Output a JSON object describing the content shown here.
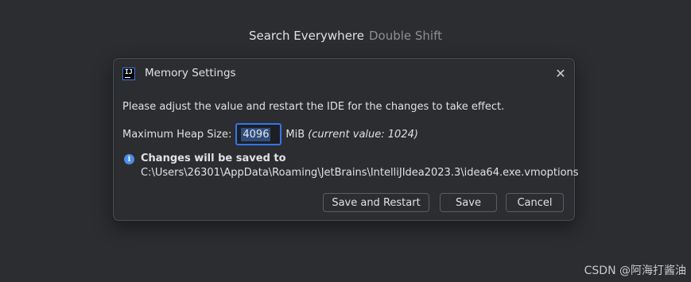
{
  "search_hint": {
    "label": "Search Everywhere",
    "shortcut": "Double Shift"
  },
  "dialog": {
    "title": "Memory Settings",
    "app_icon": "intellij-idea-icon",
    "close_icon": "close-icon",
    "message": "Please adjust the value and restart the IDE for the changes to take effect.",
    "heap": {
      "label": "Maximum Heap Size:",
      "value": "4096",
      "unit": "MiB",
      "current": "(current value: 1024)"
    },
    "info": {
      "icon": "info-icon",
      "title": "Changes will be saved to",
      "path": "C:\\Users\\26301\\AppData\\Roaming\\JetBrains\\IntelliJIdea2023.3\\idea64.exe.vmoptions"
    },
    "buttons": {
      "save_restart": "Save and Restart",
      "save": "Save",
      "cancel": "Cancel"
    }
  },
  "watermark": "CSDN @阿海打酱油",
  "colors": {
    "background": "#2b2d30",
    "accent": "#3574f0",
    "info": "#4f8de6"
  }
}
